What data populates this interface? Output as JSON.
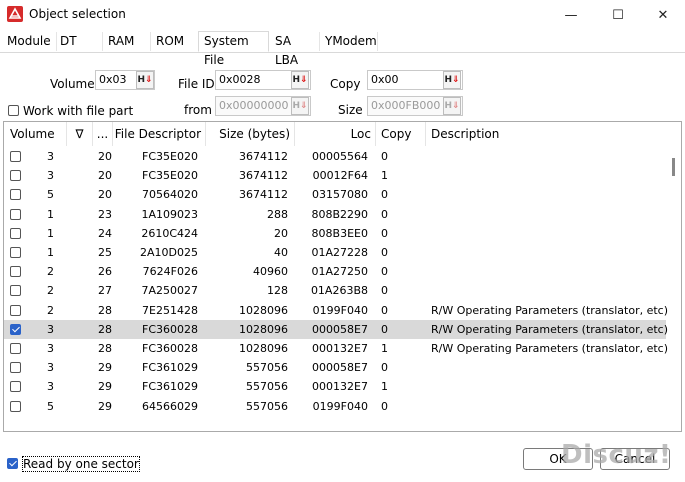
{
  "window": {
    "title": "Object selection",
    "minimize_glyph": "—",
    "maximize_glyph": "☐",
    "close_glyph": "✕"
  },
  "tabs": [
    {
      "label": "Module"
    },
    {
      "label": "DT"
    },
    {
      "label": "RAM"
    },
    {
      "label": "ROM"
    },
    {
      "label": "System File",
      "active": true
    },
    {
      "label": "SA LBA"
    },
    {
      "label": "YModem"
    }
  ],
  "form": {
    "volume_label": "Volume",
    "volume_value": "0x03",
    "fileid_label": "File ID",
    "fileid_value": "0x0028",
    "copy_label": "Copy",
    "copy_value": "0x00",
    "work_with_file_part_label": "Work with file part",
    "work_with_file_part_checked": false,
    "from_label": "from",
    "from_value": "0x00000000",
    "size_label": "Size",
    "size_value": "0x000FB000",
    "hex_button_label": "H",
    "hex_button_arrow": "⇓"
  },
  "list": {
    "columns": [
      {
        "label": "Volume"
      },
      {
        "label": "∇"
      },
      {
        "label": "..."
      },
      {
        "label": "File Descriptor"
      },
      {
        "label": "Size (bytes)"
      },
      {
        "label": "Loc"
      },
      {
        "label": "Copy"
      },
      {
        "label": "Description"
      }
    ],
    "rows": [
      {
        "checked": false,
        "volume": "3",
        "id": "20",
        "descriptor": "FC35E020",
        "size": "3674112",
        "loc": "00005564",
        "copy": "0",
        "description": ""
      },
      {
        "checked": false,
        "volume": "3",
        "id": "20",
        "descriptor": "FC35E020",
        "size": "3674112",
        "loc": "00012F64",
        "copy": "1",
        "description": ""
      },
      {
        "checked": false,
        "volume": "5",
        "id": "20",
        "descriptor": "70564020",
        "size": "3674112",
        "loc": "03157080",
        "copy": "0",
        "description": ""
      },
      {
        "checked": false,
        "volume": "1",
        "id": "23",
        "descriptor": "1A109023",
        "size": "288",
        "loc": "808B2290",
        "copy": "0",
        "description": ""
      },
      {
        "checked": false,
        "volume": "1",
        "id": "24",
        "descriptor": "2610C424",
        "size": "20",
        "loc": "808B3EE0",
        "copy": "0",
        "description": ""
      },
      {
        "checked": false,
        "volume": "1",
        "id": "25",
        "descriptor": "2A10D025",
        "size": "40",
        "loc": "01A27228",
        "copy": "0",
        "description": ""
      },
      {
        "checked": false,
        "volume": "2",
        "id": "26",
        "descriptor": "7624F026",
        "size": "40960",
        "loc": "01A27250",
        "copy": "0",
        "description": ""
      },
      {
        "checked": false,
        "volume": "2",
        "id": "27",
        "descriptor": "7A250027",
        "size": "128",
        "loc": "01A263B8",
        "copy": "0",
        "description": ""
      },
      {
        "checked": false,
        "volume": "2",
        "id": "28",
        "descriptor": "7E251428",
        "size": "1028096",
        "loc": "0199F040",
        "copy": "0",
        "description": "R/W Operating Parameters (translator, etc)"
      },
      {
        "checked": true,
        "selected": true,
        "volume": "3",
        "id": "28",
        "descriptor": "FC360028",
        "size": "1028096",
        "loc": "000058E7",
        "copy": "0",
        "description": "R/W Operating Parameters (translator, etc)"
      },
      {
        "checked": false,
        "volume": "3",
        "id": "28",
        "descriptor": "FC360028",
        "size": "1028096",
        "loc": "000132E7",
        "copy": "1",
        "description": "R/W Operating Parameters (translator, etc)"
      },
      {
        "checked": false,
        "volume": "3",
        "id": "29",
        "descriptor": "FC361029",
        "size": "557056",
        "loc": "000058E7",
        "copy": "0",
        "description": ""
      },
      {
        "checked": false,
        "volume": "3",
        "id": "29",
        "descriptor": "FC361029",
        "size": "557056",
        "loc": "000132E7",
        "copy": "1",
        "description": ""
      },
      {
        "checked": false,
        "volume": "5",
        "id": "29",
        "descriptor": "64566029",
        "size": "557056",
        "loc": "0199F040",
        "copy": "0",
        "description": ""
      }
    ]
  },
  "bottom": {
    "read_by_one_sector_label": "Read by one sector",
    "read_by_one_sector_checked": true,
    "ok_label": "OK",
    "cancel_label": "Cancel"
  },
  "watermark": "Discuz!",
  "colors": {
    "accent": "#2a62c9",
    "app_icon": "#d62b2b",
    "selected_row": "#d9d9d9",
    "hex_arrow": "#d11111"
  }
}
